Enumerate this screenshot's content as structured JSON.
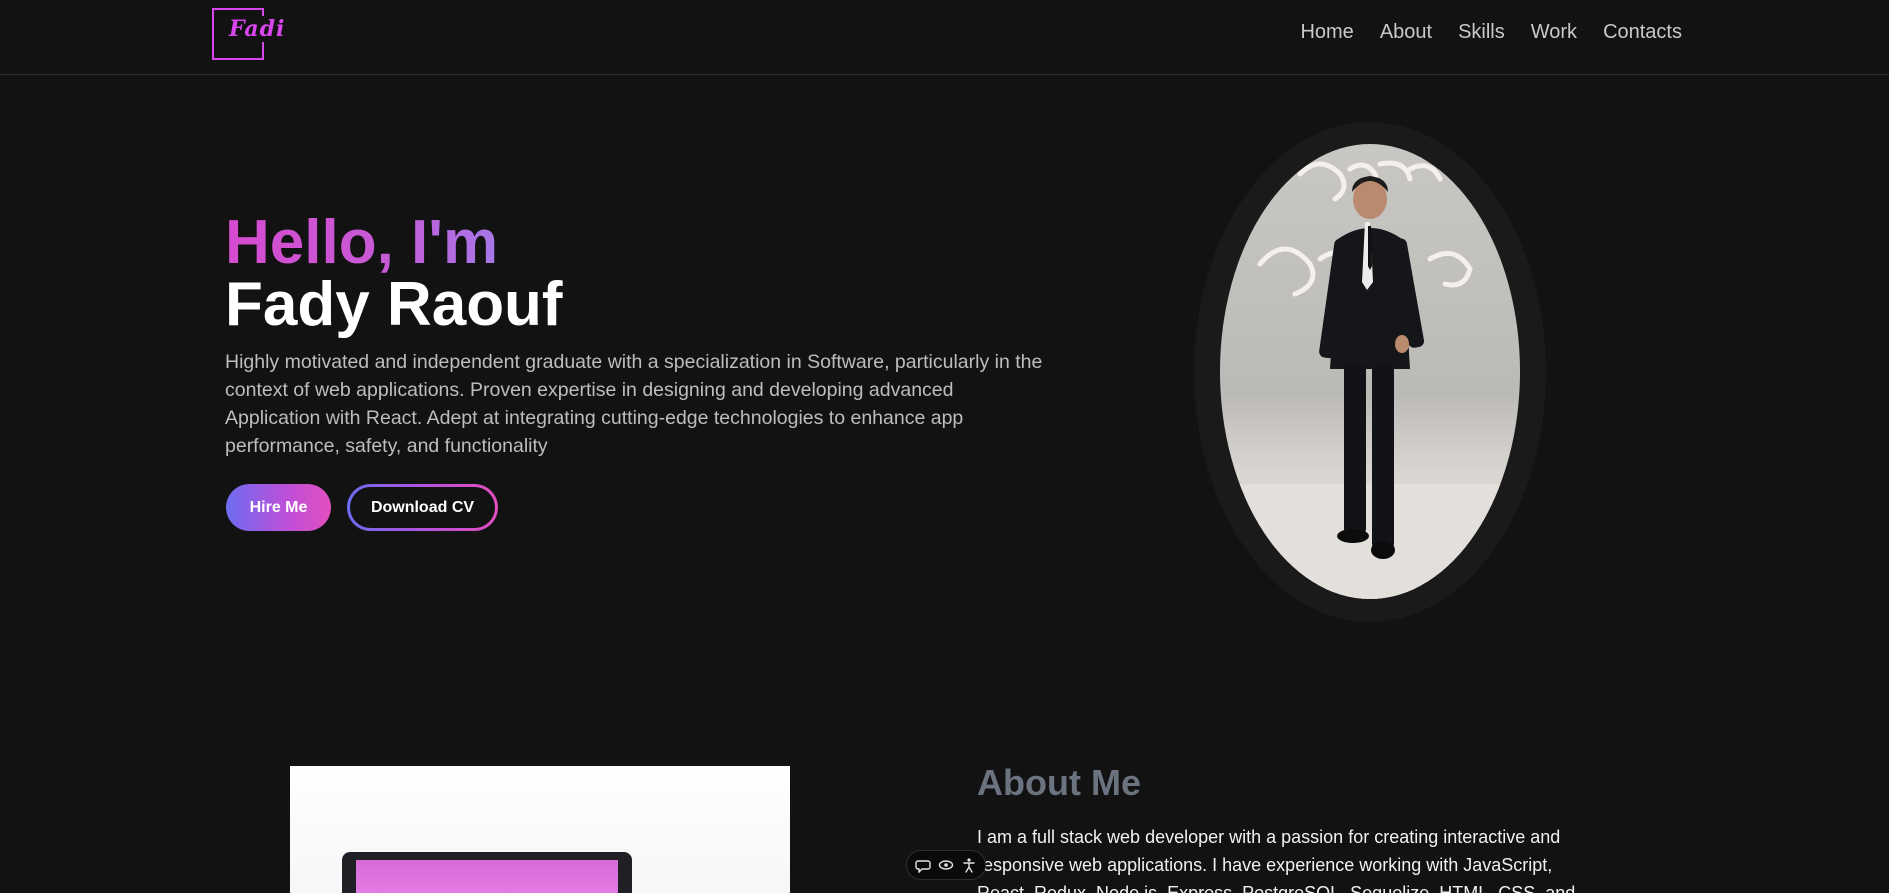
{
  "header": {
    "logo_text": "Fadi",
    "nav": [
      "Home",
      "About",
      "Skills",
      "Work",
      "Contacts"
    ]
  },
  "hero": {
    "greeting": "Hello, I'm",
    "name": "Fady Raouf",
    "description": "Highly motivated and independent graduate with a specialization in Software, particularly in the context of web applications. Proven expertise in designing and developing advanced Application with React. Adept at integrating cutting-edge technologies to enhance app performance, safety, and functionality",
    "hire_label": "Hire Me",
    "cv_label": "Download CV"
  },
  "about": {
    "title": "About Me",
    "text": "I am a full stack web developer with a passion for creating interactive and responsive web applications. I have experience working with JavaScript, React, Redux, Node.js, Express, PostgreSQL, Sequelize, HTML, CSS, and"
  },
  "float_bar": {
    "icons": [
      "chat-icon",
      "eye-icon",
      "accessibility-icon"
    ]
  },
  "colors": {
    "background": "#121212",
    "accent_pink": "#d946ef",
    "accent_blue": "#6d6cf0",
    "nav_text": "#c9c9c9",
    "about_title": "#6b7280"
  }
}
